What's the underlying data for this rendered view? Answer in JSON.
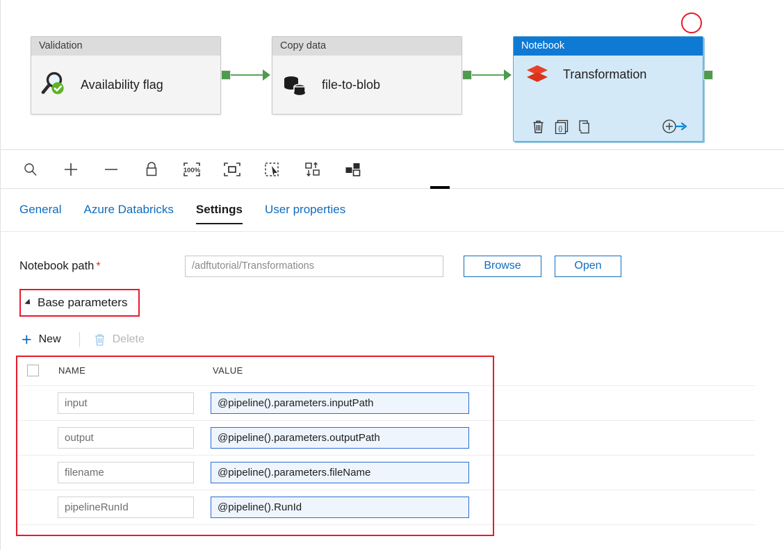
{
  "canvas": {
    "activities": [
      {
        "type_label": "Validation",
        "name": "Availability flag",
        "icon": "magnifier-check-icon",
        "selected": false
      },
      {
        "type_label": "Copy data",
        "name": "file-to-blob",
        "icon": "database-copy-icon",
        "selected": false
      },
      {
        "type_label": "Notebook",
        "name": "Transformation",
        "icon": "databricks-stack-icon",
        "selected": true
      }
    ],
    "notebook_actions": [
      {
        "name": "delete-activity",
        "icon": "trash-icon"
      },
      {
        "name": "view-code",
        "icon": "code-braces-icon"
      },
      {
        "name": "clone-activity",
        "icon": "copy-pages-icon"
      },
      {
        "name": "add-output-dependency",
        "icon": "add-arrow-icon"
      }
    ],
    "annotation_circle_color": "#e8192c",
    "connector_color": "#4e9a4e",
    "selected_header_color": "#0f7ad4"
  },
  "toolbar": {
    "buttons": [
      {
        "label": "Zoom",
        "icon": "magnifier-icon"
      },
      {
        "label": "Zoom in",
        "icon": "plus-icon"
      },
      {
        "label": "Zoom out",
        "icon": "minus-icon"
      },
      {
        "label": "Lock canvas",
        "icon": "lock-icon"
      },
      {
        "label": "Zoom to 100%",
        "icon": "zoom-100-percent-icon",
        "text": "100%"
      },
      {
        "label": "Zoom to fit",
        "icon": "fit-to-screen-icon"
      },
      {
        "label": "Select mode",
        "icon": "selection-cursor-icon"
      },
      {
        "label": "Auto align",
        "icon": "auto-align-icon"
      },
      {
        "label": "Arrange layout",
        "icon": "layout-blocks-icon"
      }
    ]
  },
  "tabs": [
    {
      "label": "General",
      "active": false
    },
    {
      "label": "Azure Databricks",
      "active": false
    },
    {
      "label": "Settings",
      "active": true
    },
    {
      "label": "User properties",
      "active": false
    }
  ],
  "settings": {
    "notebook_path": {
      "label": "Notebook path",
      "required_marker": "*",
      "value": "/adftutorial/Transformations",
      "placeholder": "/adftutorial/Transformations"
    },
    "browse_button": "Browse",
    "open_button": "Open",
    "base_parameters": {
      "section_label": "Base parameters",
      "expanded": true,
      "new_button": "New",
      "delete_button": "Delete",
      "delete_enabled": false,
      "columns": [
        "NAME",
        "VALUE"
      ],
      "rows": [
        {
          "name": "input",
          "value": "@pipeline().parameters.inputPath"
        },
        {
          "name": "output",
          "value": "@pipeline().parameters.outputPath"
        },
        {
          "name": "filename",
          "value": "@pipeline().parameters.fileName"
        },
        {
          "name": "pipelineRunId",
          "value": "@pipeline().RunId"
        }
      ]
    }
  }
}
